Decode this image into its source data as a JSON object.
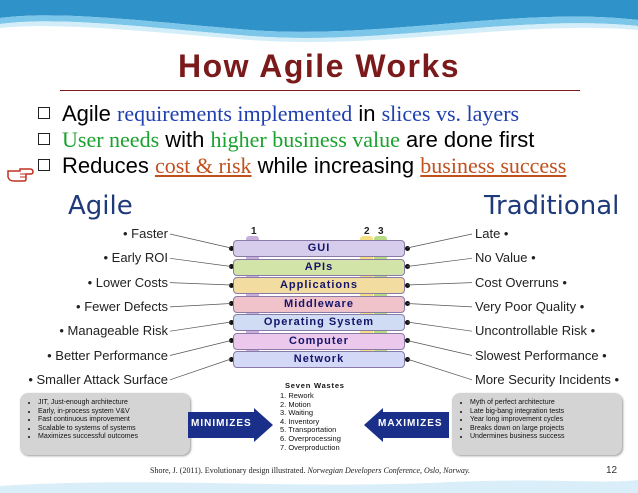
{
  "title": "How Agile Works",
  "bullets": [
    {
      "parts": [
        {
          "t": "Agile ",
          "c": "plain"
        },
        {
          "t": "requirements implemented",
          "c": "blue"
        },
        {
          "t": " in ",
          "c": "plain"
        },
        {
          "t": "slices vs. layers",
          "c": "blue"
        }
      ]
    },
    {
      "parts": [
        {
          "t": "User needs",
          "c": "green"
        },
        {
          "t": " with ",
          "c": "plain"
        },
        {
          "t": "higher business value",
          "c": "green"
        },
        {
          "t": " are done first",
          "c": "plain"
        }
      ]
    },
    {
      "parts": [
        {
          "t": "Reduces ",
          "c": "plain"
        },
        {
          "t": "cost & risk",
          "c": "orange"
        },
        {
          "t": " while increasing ",
          "c": "plain"
        },
        {
          "t": "business success",
          "c": "orange"
        }
      ]
    }
  ],
  "agile_heading": "Agile",
  "traditional_heading": "Traditional",
  "agile_items": [
    "• Faster",
    "• Early ROI",
    "• Lower Costs",
    "• Fewer Defects",
    "• Manageable Risk",
    "• Better Performance",
    "• Smaller Attack Surface"
  ],
  "traditional_items": [
    "Late •",
    "No Value •",
    "Cost Overruns •",
    "Very Poor Quality •",
    "Uncontrollable Risk •",
    "Slowest Performance •",
    "More Security Incidents •"
  ],
  "layers": [
    {
      "label": "GUI",
      "color": "#d6ccec"
    },
    {
      "label": "APIs",
      "color": "#d3e4a8"
    },
    {
      "label": "Applications",
      "color": "#f2dca0"
    },
    {
      "label": "Middleware",
      "color": "#f0c2c9"
    },
    {
      "label": "Operating System",
      "color": "#cfdcf3"
    },
    {
      "label": "Computer",
      "color": "#ecc8ec"
    },
    {
      "label": "Network",
      "color": "#d2d8f5"
    }
  ],
  "slice_labels": [
    "1",
    "2",
    "3"
  ],
  "seven_wastes": {
    "title": "Seven Wastes",
    "items": [
      "1. Rework",
      "2. Motion",
      "3. Waiting",
      "4. Inventory",
      "5. Transportation",
      "6. Overprocessing",
      "7. Overproduction"
    ]
  },
  "minimizes_label": "MINIMIZES",
  "maximizes_label": "MAXIMIZES",
  "left_box": [
    "JIT, Just-enough architecture",
    "Early, in-process system V&V",
    "Fast continuous improvement",
    "Scalable to systems of systems",
    "Maximizes successful outcomes"
  ],
  "right_box": [
    "Myth of perfect architecture",
    "Late big-bang integration tests",
    "Year long improvement cycles",
    "Breaks down on large projects",
    "Undermines business success"
  ],
  "citation_plain": "Shore, J. (2011). Evolutionary design illustrated. ",
  "citation_italic": "Norwegian Developers Conference, Oslo, Norway.",
  "page_number": "12",
  "colors": {
    "title": "#7a1a1a",
    "heading": "#1f3a7a",
    "blue": "#1f3fb0",
    "green": "#1aa22e",
    "orange": "#c0501e",
    "slice1": "#9a6bc0",
    "slice2": "#f3d35a",
    "slice3": "#9ed05a",
    "arrow": "#1a2f8a"
  },
  "icons": {
    "pointer": "pointing-hand-icon"
  }
}
